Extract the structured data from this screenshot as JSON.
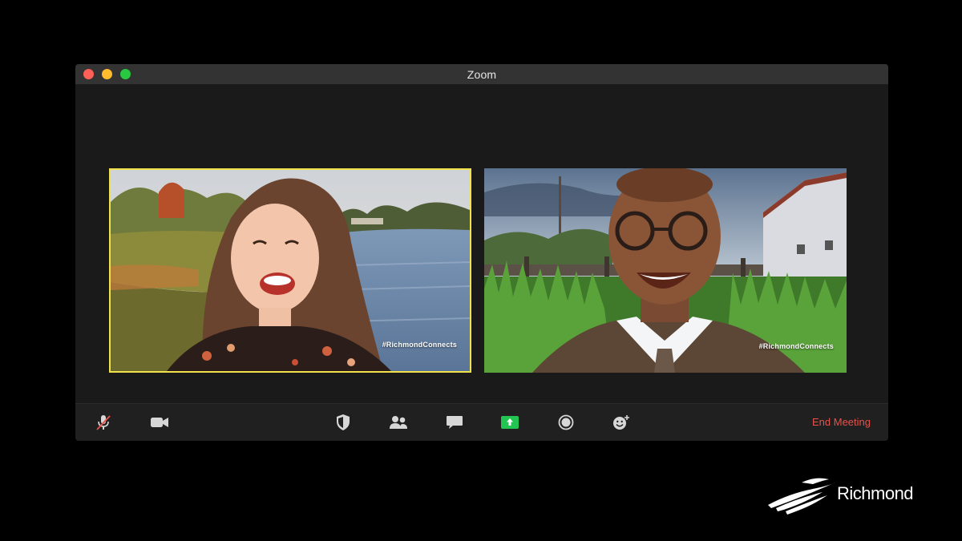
{
  "window": {
    "title": "Zoom",
    "controls": [
      "close",
      "minimize",
      "zoom"
    ]
  },
  "participants": [
    {
      "hashtag": "#RichmondConnects",
      "active_speaker": true
    },
    {
      "hashtag": "#RichmondConnects",
      "active_speaker": false
    }
  ],
  "toolbar": {
    "items": [
      {
        "icon": "microphone-muted-icon"
      },
      {
        "icon": "video-camera-icon"
      },
      {
        "icon": "security-shield-icon"
      },
      {
        "icon": "participants-icon"
      },
      {
        "icon": "chat-icon"
      },
      {
        "icon": "share-screen-icon"
      },
      {
        "icon": "record-icon"
      },
      {
        "icon": "reactions-icon"
      }
    ],
    "end_meeting_label": "End Meeting"
  },
  "brand": {
    "text": "Richmond"
  },
  "colors": {
    "active_speaker_border": "#f2e24a",
    "share_accent": "#23c552",
    "end_meeting": "#e5534b"
  }
}
